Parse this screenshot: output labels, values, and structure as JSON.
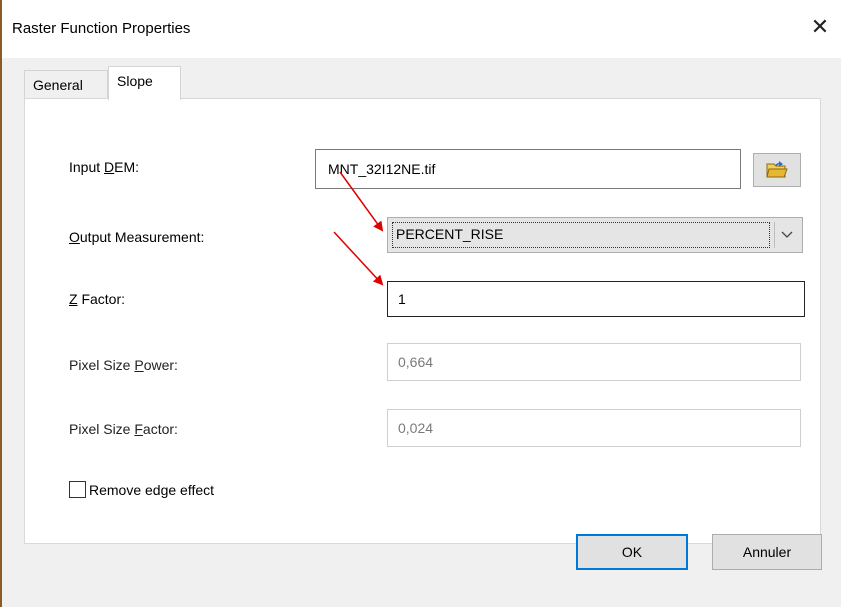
{
  "window": {
    "title": "Raster Function Properties",
    "close_symbol": "✕"
  },
  "tabs": [
    {
      "label": "General",
      "active": false
    },
    {
      "label": "Slope",
      "active": true
    }
  ],
  "fields": {
    "input_dem": {
      "label_pre": "Input ",
      "label_mnemonic": "D",
      "label_post": "EM:",
      "value": "MNT_32I12NE.tif",
      "browse_icon": "folder-open-icon"
    },
    "output_measurement": {
      "label_mnemonic": "O",
      "label_post": "utput Measurement:",
      "value": "PERCENT_RISE",
      "dropdown_icon": "chevron-down-icon"
    },
    "z_factor": {
      "label_mnemonic": "Z",
      "label_post": " Factor:",
      "value": "1"
    },
    "pixel_size_power": {
      "label_pre": "Pixel Size ",
      "label_mnemonic": "P",
      "label_post": "ower:",
      "value": "0,664"
    },
    "pixel_size_factor": {
      "label_pre": "Pixel Size ",
      "label_mnemonic": "F",
      "label_post": "actor:",
      "value": "0,024"
    },
    "remove_edge_effect": {
      "label": "Remove edge effect",
      "checked": false
    }
  },
  "buttons": {
    "ok": "OK",
    "cancel": "Annuler"
  },
  "colors": {
    "annotation_arrow": "#e00000",
    "focus_border": "#0078d7",
    "folder_icon": "#e8b732"
  }
}
